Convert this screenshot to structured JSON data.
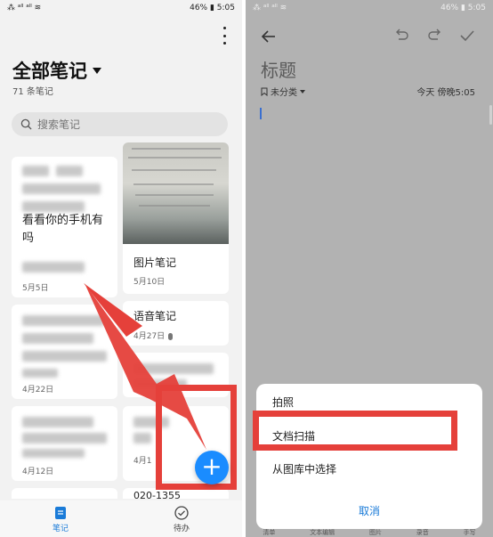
{
  "left": {
    "status": {
      "left": "⁂ ᵃˡˡ ᵃˡˡ ≋",
      "right": "46% ▮ 5:05"
    },
    "header": {
      "title": "全部笔记",
      "count": "71 条笔记"
    },
    "search": {
      "placeholder": "搜索笔记"
    },
    "notes": {
      "col1": [
        {
          "text_line1": "看看你的手机有",
          "text_line2": "吗",
          "date": "5月5日"
        },
        {
          "date": "4月22日"
        },
        {
          "date": "4月12日"
        }
      ],
      "col2": [
        {
          "title": "图片笔记",
          "date": "5月10日"
        },
        {
          "title": "语音笔记",
          "date": "4月27日"
        },
        {
          "date": "4月1"
        },
        {
          "title": "020-1355"
        }
      ]
    },
    "tabs": [
      {
        "label": "笔记",
        "active": true
      },
      {
        "label": "待办",
        "active": false
      }
    ],
    "fab_label": "+"
  },
  "right": {
    "status": {
      "left": "⁂ ᵃˡˡ ᵃˡˡ ≋",
      "right": "46% ▮ 5:05"
    },
    "editor": {
      "title_placeholder": "标题",
      "category": "未分类",
      "timestamp": "今天 傍晚5:05"
    },
    "sheet": {
      "options": [
        "拍照",
        "文档扫描",
        "从图库中选择"
      ],
      "cancel": "取消"
    },
    "behind_tabs": [
      "清单",
      "文本编辑",
      "图片",
      "录音",
      "手写"
    ]
  },
  "colors": {
    "accent": "#1a8cff",
    "highlight": "#e5403a"
  }
}
